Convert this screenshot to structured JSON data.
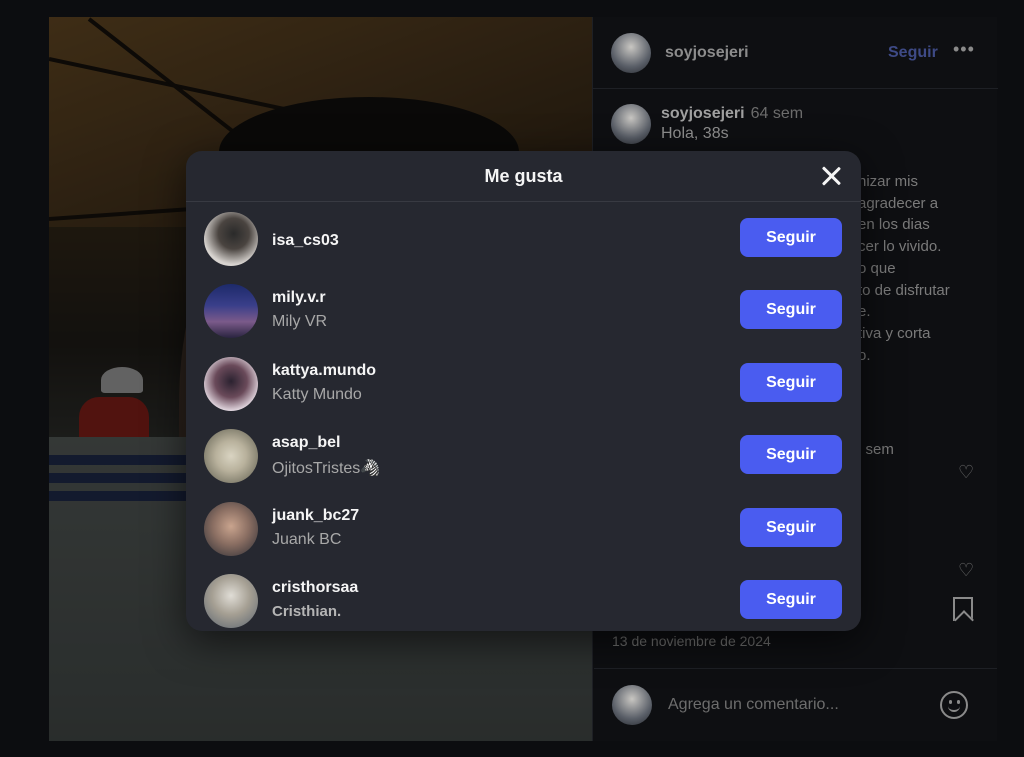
{
  "colors": {
    "accent": "#4a5cf0",
    "modal_bg": "#262830",
    "page_bg": "#0c0d10"
  },
  "post": {
    "author": "soyjosejeri",
    "follow_label": "Seguir",
    "more_icon": "more-icon",
    "caption_user": "soyjosejeri",
    "caption_time": "64 sem",
    "caption_text": "Hola, 38s",
    "caption_lines": [
      "nizar mis",
      "agradecer a",
      "en los dias",
      "cer lo vivido.",
      "o que",
      "to de disfrutar",
      "e.",
      "tiva y corta",
      "o."
    ],
    "comment_time": "l sem",
    "date": "13 de noviembre de 2024",
    "comment_placeholder": "Agrega un comentario...",
    "icons": [
      "heart-icon",
      "bookmark-icon",
      "emoji-icon"
    ]
  },
  "modal": {
    "title": "Me gusta",
    "close_icon": "close-icon",
    "users": [
      {
        "username": "isa_cs03",
        "fullname": "",
        "button": "Seguir"
      },
      {
        "username": "mily.v.r",
        "fullname": "Mily VR",
        "button": "Seguir"
      },
      {
        "username": "kattya.mundo",
        "fullname": "Katty Mundo",
        "button": "Seguir"
      },
      {
        "username": "asap_bel",
        "fullname": "OjitosTristes🦓",
        "button": "Seguir"
      },
      {
        "username": "juank_bc27",
        "fullname": "Juank BC",
        "button": "Seguir"
      },
      {
        "username": "cristhorsaa",
        "fullname": "Cristhian.",
        "button": "Seguir"
      }
    ]
  }
}
